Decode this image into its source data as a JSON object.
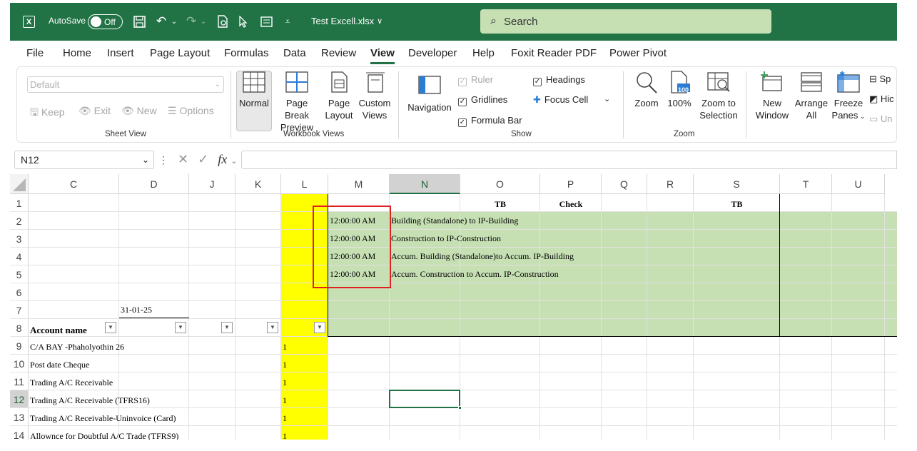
{
  "titlebar": {
    "app_icon": "excel-icon",
    "autosave_label": "AutoSave",
    "autosave_state": "Off",
    "filename": "Test Excell.xlsx",
    "filename_chevron": "∨",
    "search_placeholder": "Search",
    "bg_color": "#217346"
  },
  "menu": {
    "tabs": [
      "File",
      "Home",
      "Insert",
      "Page Layout",
      "Formulas",
      "Data",
      "Review",
      "View",
      "Developer",
      "Help",
      "Foxit Reader PDF",
      "Power Pivot"
    ],
    "active_tab": "View"
  },
  "ribbon": {
    "sheet_view": {
      "dropdown_value": "Default",
      "keep": "Keep",
      "exit": "Exit",
      "new": "New",
      "options": "Options",
      "label": "Sheet View"
    },
    "workbook_views": {
      "normal": "Normal",
      "page_break_1": "Page Break",
      "page_break_2": "Preview",
      "page_layout_1": "Page",
      "page_layout_2": "Layout",
      "custom_1": "Custom",
      "custom_2": "Views",
      "label": "Workbook Views"
    },
    "show": {
      "navigation": "Navigation",
      "ruler": "Ruler",
      "gridlines": "Gridlines",
      "formula_bar": "Formula Bar",
      "headings": "Headings",
      "focus_cell": "Focus Cell",
      "label": "Show"
    },
    "zoom": {
      "zoom": "Zoom",
      "hundred": "100%",
      "hundred_icon_text": "100",
      "zoom_sel_1": "Zoom to",
      "zoom_sel_2": "Selection",
      "label": "Zoom"
    },
    "window": {
      "new_1": "New",
      "new_2": "Window",
      "arrange_1": "Arrange",
      "arrange_2": "All",
      "freeze_1": "Freeze",
      "freeze_2": "Panes",
      "split": "Sp",
      "hide": "Hic",
      "unhide": "Un"
    }
  },
  "formula_bar": {
    "name_box": "N12",
    "fx": "fx",
    "formula": ""
  },
  "grid": {
    "columns": [
      "C",
      "D",
      "J",
      "K",
      "L",
      "M",
      "N",
      "O",
      "P",
      "Q",
      "R",
      "S",
      "T",
      "U"
    ],
    "selected_column": "N",
    "rows": [
      "1",
      "2",
      "3",
      "4",
      "5",
      "6",
      "7",
      "8",
      "9",
      "10",
      "11",
      "12",
      "13",
      "14"
    ],
    "selected_row": "12",
    "headers_row1": {
      "O": "TB",
      "P": "Check",
      "S": "TB"
    },
    "times": [
      "12:00:00 AM",
      "12:00:00 AM",
      "12:00:00 AM",
      "12:00:00 AM"
    ],
    "descriptions": [
      "Building (Standalone) to IP-Building",
      "Construction to IP-Construction",
      "Accum. Building (Standalone)to Accum. IP-Building",
      "Accum. Construction to Accum. IP-Construction"
    ],
    "date_d7": "31-01-25",
    "account_header": "Account name",
    "accounts": [
      "C/A BAY -Phaholyothin 26",
      "Post date Cheque",
      "Trading A/C Receivable",
      "Trading A/C Receivable (TFRS16)",
      "Trading A/C Receivable-Uninvoice (Card)",
      "Allownce for Doubtful A/C Trade (TFRS9)"
    ],
    "l_values": [
      "1",
      "1",
      "1",
      "1",
      "1",
      "1"
    ],
    "colors": {
      "yellow": "#ffff00",
      "green": "#c6e0b4",
      "highlight_box": "#e02020"
    }
  }
}
